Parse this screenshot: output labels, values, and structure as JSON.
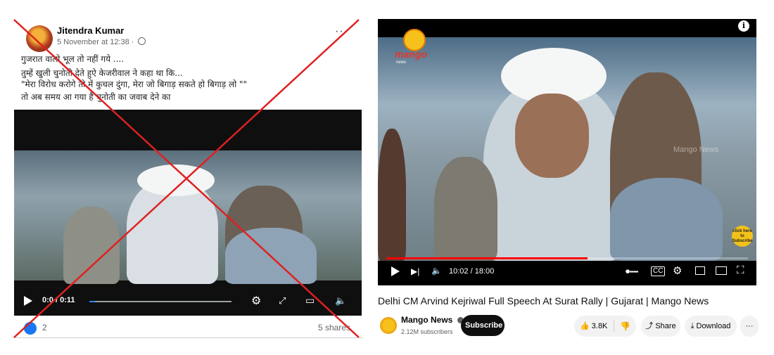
{
  "facebook_post": {
    "author": "Jitendra Kumar",
    "meta": "5 November at 12:38 ·",
    "more_menu": "··",
    "text_lines": [
      "गुजरात वालो भूल तो नहीं गये ....",
      "तुम्हें खुली चुनोती देते हुऐ केजरीवाल ने कहा था कि...",
      "\"मेरा विरोध करोगे तो में कुचल दुंगा, मेरा जो बिगाड़ सकते हो बिगाड़ लो \"\"",
      "तो अब समय आ गया है चुनोती का जवाब देने का"
    ],
    "video": {
      "time": "0:0 / 0:11",
      "progress_fraction": 0.04
    },
    "reactions_count": "2",
    "shares": "5 shares",
    "cross_color": "#e02020"
  },
  "youtube": {
    "logo_text": "mango",
    "logo_subtext": "news",
    "watermark": "Mango News",
    "badge_text": "click here to Subscribe",
    "time": "10:02 / 18:00",
    "progress_fraction": 0.557,
    "title": "Delhi CM Arvind Kejriwal Full Speech At Surat Rally | Gujarat | Mango News",
    "channel_name": "Mango News",
    "subscribers": "2.12M subscribers",
    "subscribe_label": "Subscribe",
    "likes": "3.8K",
    "share_label": "Share",
    "download_label": "Download",
    "more_label": "···",
    "info_label": "i",
    "accent_color": "#ff0000"
  },
  "icons": {
    "play": "▶",
    "next": "▶|",
    "volume": "🔈",
    "settings": "⚙",
    "fullscreen": "⛶",
    "like": "👍",
    "dislike": "👎",
    "share": "⤴",
    "download": "⤓"
  }
}
